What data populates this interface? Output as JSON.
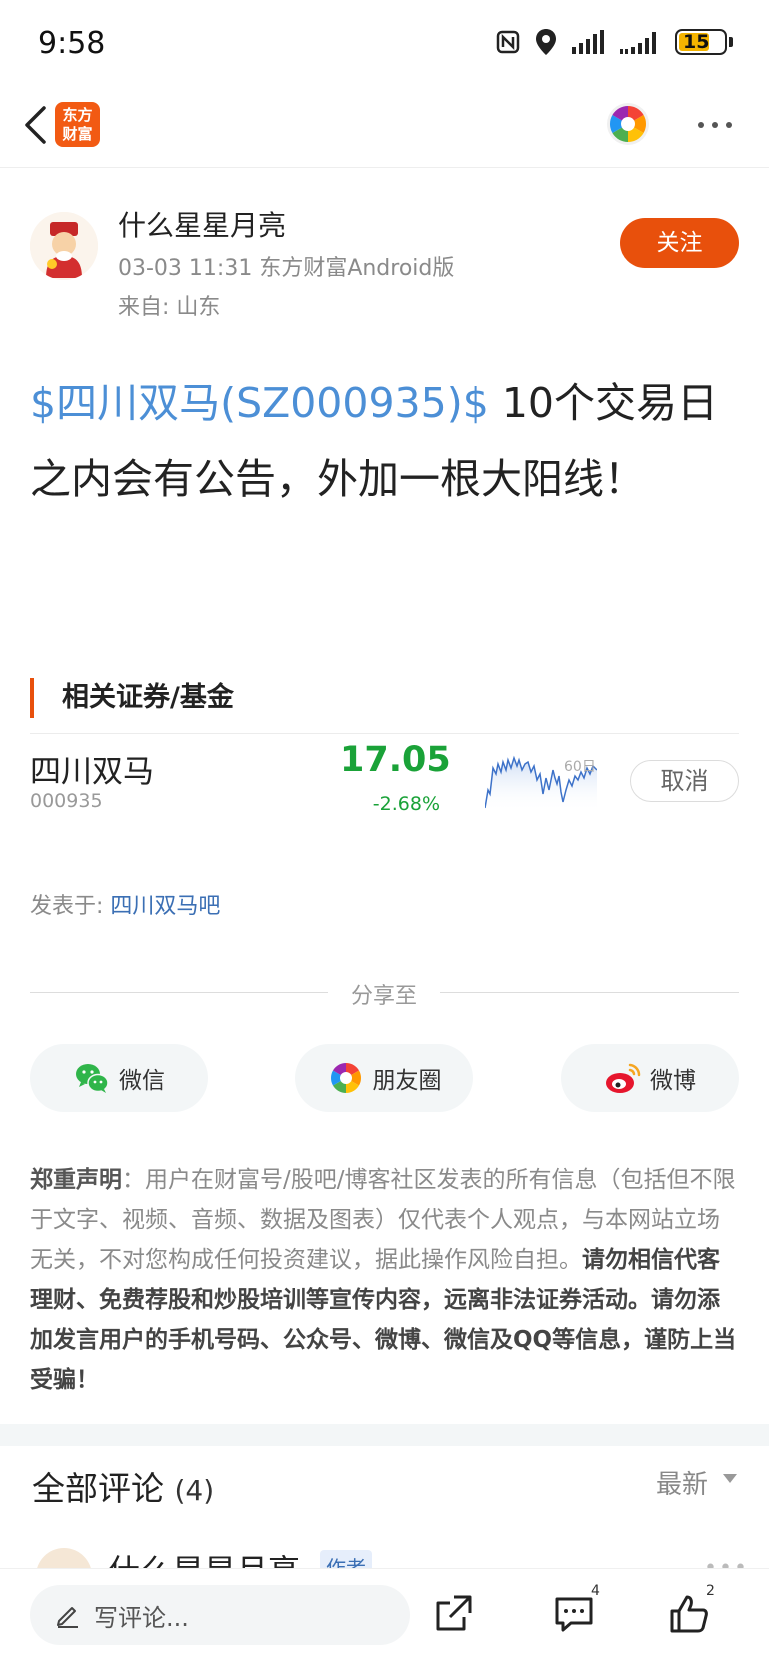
{
  "status_bar": {
    "time": "9:58",
    "battery": "15"
  },
  "nav": {
    "logo_line1": "东方",
    "logo_line2": "财富"
  },
  "author": {
    "name": "什么星星月亮",
    "meta": "03-03 11:31 东方财富Android版",
    "location": "来自: 山东",
    "follow_label": "关注"
  },
  "post": {
    "stock_tag": "$四川双马(SZ000935)$",
    "text": " 10个交易日之内会有公告，外加一根大阳线！"
  },
  "related": {
    "title": "相关证券/基金",
    "stock": {
      "name": "四川双马",
      "code": "000935",
      "price": "17.05",
      "change": "-2.68%",
      "sparkline_label": "60日",
      "action_label": "取消"
    }
  },
  "posted_in": {
    "prefix": "发表于: ",
    "bar": "四川双马吧"
  },
  "share": {
    "label": "分享至",
    "wechat": "微信",
    "moments": "朋友圈",
    "weibo": "微博"
  },
  "disclaimer": {
    "lead": "郑重声明",
    "colon": "：",
    "body": "用户在财富号/股吧/博客社区发表的所有信息（包括但不限于文字、视频、音频、数据及图表）仅代表个人观点，与本网站立场无关，不对您构成任何投资建议，据此操作风险自担。",
    "warning": "请勿相信代客理财、免费荐股和炒股培训等宣传内容，远离非法证券活动。请勿添加发言用户的手机号码、公众号、微博、微信及QQ等信息，谨防上当受骗！"
  },
  "comments": {
    "title": "全部评论",
    "count": "(4)",
    "sort_label": "最新",
    "peek_name": "什么星星月亮",
    "peek_badge": "作者",
    "peek_dots": "•••"
  },
  "bottom_bar": {
    "input_placeholder": "写评论...",
    "comment_count": "4",
    "like_count": "2"
  },
  "colors": {
    "accent": "#e8500c",
    "stock_link": "#4c8fd6",
    "price_down": "#1aa238"
  }
}
